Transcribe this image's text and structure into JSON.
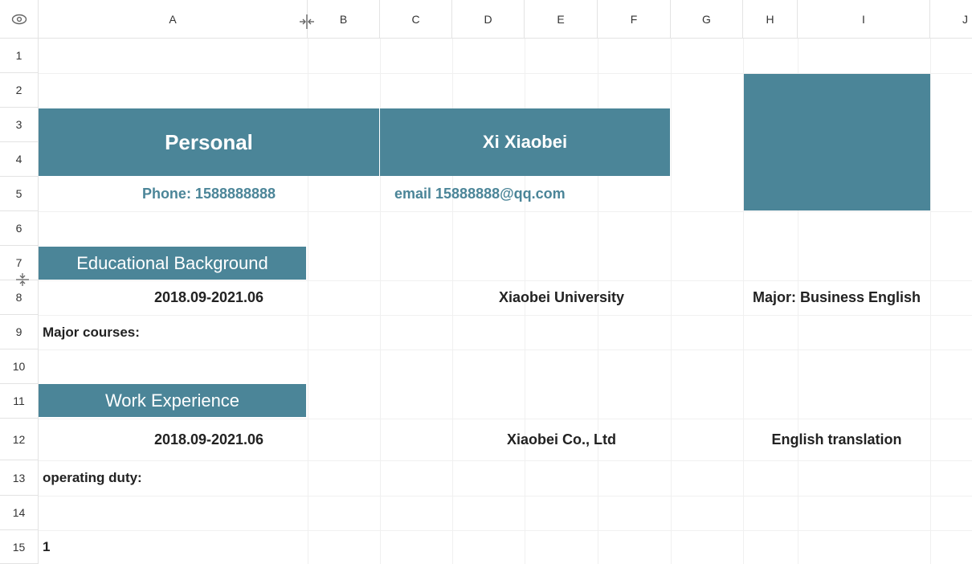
{
  "columns": [
    "A",
    "B",
    "C",
    "D",
    "E",
    "F",
    "G",
    "H",
    "I",
    "J"
  ],
  "rows": [
    "1",
    "2",
    "3",
    "4",
    "5",
    "6",
    "7",
    "8",
    "9",
    "10",
    "11",
    "12",
    "13",
    "14",
    "15"
  ],
  "header": {
    "name_label": "Personal",
    "name_value": "Xi Xiaobei"
  },
  "contact": {
    "phone": "Phone: 1588888888",
    "email": "email 15888888@qq.com"
  },
  "education": {
    "title": "Educational Background",
    "period": "2018.09-2021.06",
    "school": "Xiaobei University",
    "major": "Major: Business English",
    "courses_label": "Major courses:"
  },
  "work": {
    "title": "Work Experience",
    "period": "2018.09-2021.06",
    "company": "Xiaobei Co., Ltd",
    "role": "English translation",
    "duty_label": "operating duty:"
  },
  "row15": {
    "value": "1"
  },
  "colors": {
    "accent": "#4b8598"
  }
}
